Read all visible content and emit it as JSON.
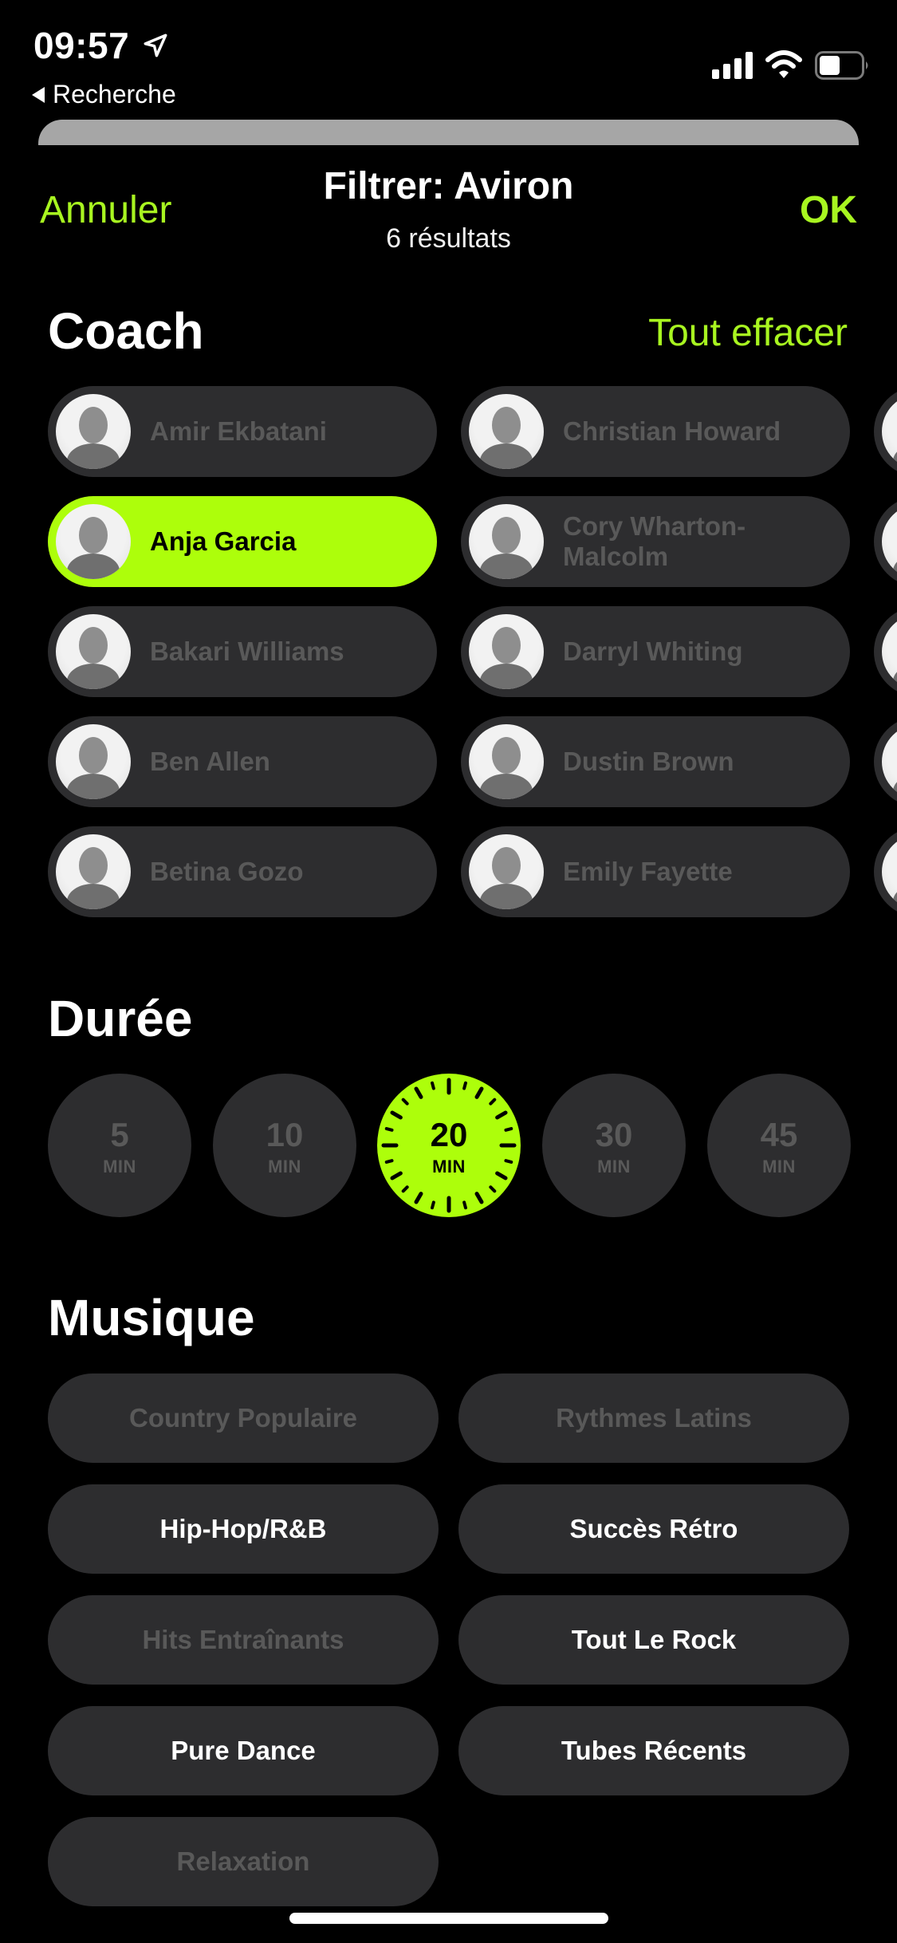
{
  "status_bar": {
    "time": "09:57",
    "back_label": "Recherche",
    "icons": [
      "location-arrow-icon",
      "cellular-signal-icon",
      "wifi-icon",
      "battery-icon"
    ],
    "battery_level": 0.5
  },
  "nav": {
    "cancel_label": "Annuler",
    "title": "Filtrer: Aviron",
    "subtitle": "6 résultats",
    "ok_label": "OK"
  },
  "colors": {
    "accent": "#adfe0b",
    "link": "#a8f520",
    "pill_bg": "#2d2d2f",
    "dim_text": "#595959",
    "background": "#000000"
  },
  "coach": {
    "heading": "Coach",
    "clear_label": "Tout effacer",
    "items": [
      {
        "name": "Amir Ekbatani",
        "selected": false
      },
      {
        "name": "Christian Howard",
        "selected": false
      },
      {
        "name": "Anja Garcia",
        "selected": true
      },
      {
        "name": "Cory Wharton-Malcolm",
        "selected": false
      },
      {
        "name": "Bakari Williams",
        "selected": false
      },
      {
        "name": "Darryl Whiting",
        "selected": false
      },
      {
        "name": "Ben Allen",
        "selected": false
      },
      {
        "name": "Dustin Brown",
        "selected": false
      },
      {
        "name": "Betina Gozo",
        "selected": false
      },
      {
        "name": "Emily Fayette",
        "selected": false
      }
    ]
  },
  "duration": {
    "heading": "Durée",
    "unit": "MIN",
    "options": [
      {
        "value": "5",
        "selected": false
      },
      {
        "value": "10",
        "selected": false
      },
      {
        "value": "20",
        "selected": true
      },
      {
        "value": "30",
        "selected": false
      },
      {
        "value": "45",
        "selected": false
      }
    ]
  },
  "music": {
    "heading": "Musique",
    "options": [
      {
        "label": "Country Populaire",
        "available": false
      },
      {
        "label": "Rythmes Latins",
        "available": false
      },
      {
        "label": "Hip-Hop/R&B",
        "available": true
      },
      {
        "label": "Succès Rétro",
        "available": true
      },
      {
        "label": "Hits Entraînants",
        "available": false
      },
      {
        "label": "Tout Le Rock",
        "available": true
      },
      {
        "label": "Pure Dance",
        "available": true
      },
      {
        "label": "Tubes Récents",
        "available": true
      },
      {
        "label": "Relaxation",
        "available": false
      }
    ]
  }
}
